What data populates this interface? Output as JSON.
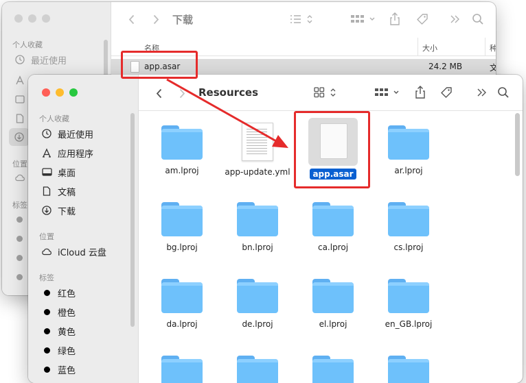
{
  "back_window": {
    "title": "下载",
    "sidebar": {
      "favorites_header": "个人收藏",
      "recent_label": "最近使用",
      "locations_header": "位置",
      "tags_header": "标签"
    },
    "columns": {
      "name": "名称",
      "size": "大小",
      "kind": "种"
    },
    "row": {
      "name": "app.asar",
      "size": "24.2 MB",
      "kind": "文"
    }
  },
  "front_window": {
    "title": "Resources",
    "sidebar": {
      "favorites_header": "个人收藏",
      "favorites": [
        {
          "label": "最近使用",
          "icon": "clock-icon"
        },
        {
          "label": "应用程序",
          "icon": "applications-icon"
        },
        {
          "label": "桌面",
          "icon": "desktop-icon"
        },
        {
          "label": "文稿",
          "icon": "document-icon"
        },
        {
          "label": "下载",
          "icon": "download-icon"
        }
      ],
      "locations_header": "位置",
      "locations": [
        {
          "label": "iCloud 云盘",
          "icon": "cloud-icon"
        }
      ],
      "tags_header": "标签",
      "tags": [
        {
          "label": "红色",
          "color": "#000000"
        },
        {
          "label": "橙色",
          "color": "#000000"
        },
        {
          "label": "黄色",
          "color": "#000000"
        },
        {
          "label": "绿色",
          "color": "#000000"
        },
        {
          "label": "蓝色",
          "color": "#000000"
        }
      ]
    },
    "files": [
      {
        "name": "am.lproj",
        "type": "folder"
      },
      {
        "name": "app-update.yml",
        "type": "yml"
      },
      {
        "name": "app.asar",
        "type": "file",
        "selected": true
      },
      {
        "name": "ar.lproj",
        "type": "folder"
      },
      {
        "name": "bg.lproj",
        "type": "folder"
      },
      {
        "name": "bn.lproj",
        "type": "folder"
      },
      {
        "name": "ca.lproj",
        "type": "folder"
      },
      {
        "name": "cs.lproj",
        "type": "folder"
      },
      {
        "name": "da.lproj",
        "type": "folder"
      },
      {
        "name": "de.lproj",
        "type": "folder"
      },
      {
        "name": "el.lproj",
        "type": "folder"
      },
      {
        "name": "en_GB.lproj",
        "type": "folder"
      }
    ]
  },
  "colors": {
    "close": "#ff5f57",
    "minimize": "#febc2e",
    "zoom": "#28c840",
    "accent": "#0a60d1",
    "annotation": "#e52b2b",
    "folder": "#6ec1fb"
  }
}
